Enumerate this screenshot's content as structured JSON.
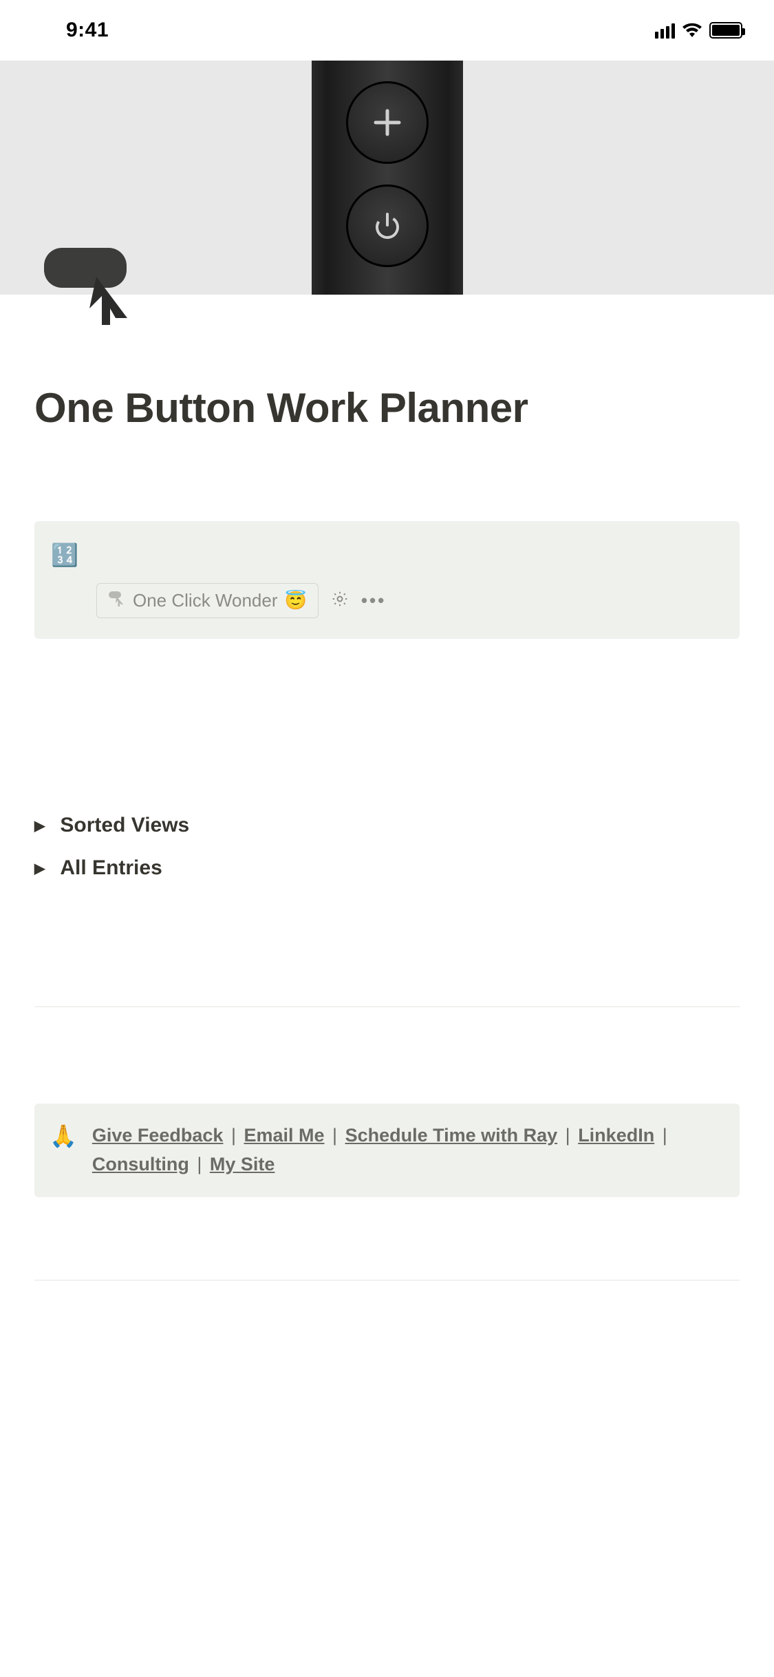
{
  "status": {
    "time": "9:41"
  },
  "page": {
    "title": "One Button Work Planner"
  },
  "callout": {
    "numbers_emoji": "🔢",
    "button_label": "One Click Wonder ",
    "halo_emoji": "😇"
  },
  "toggles": {
    "sorted_views": "Sorted Views",
    "all_entries": "All Entries"
  },
  "footer": {
    "pray_emoji": "🙏",
    "links": {
      "give_feedback": "Give Feedback",
      "email_me": "Email Me",
      "schedule": "Schedule Time with Ray",
      "linkedin": "LinkedIn",
      "consulting": "Consulting",
      "my_site": "My Site"
    },
    "sep": " | "
  }
}
